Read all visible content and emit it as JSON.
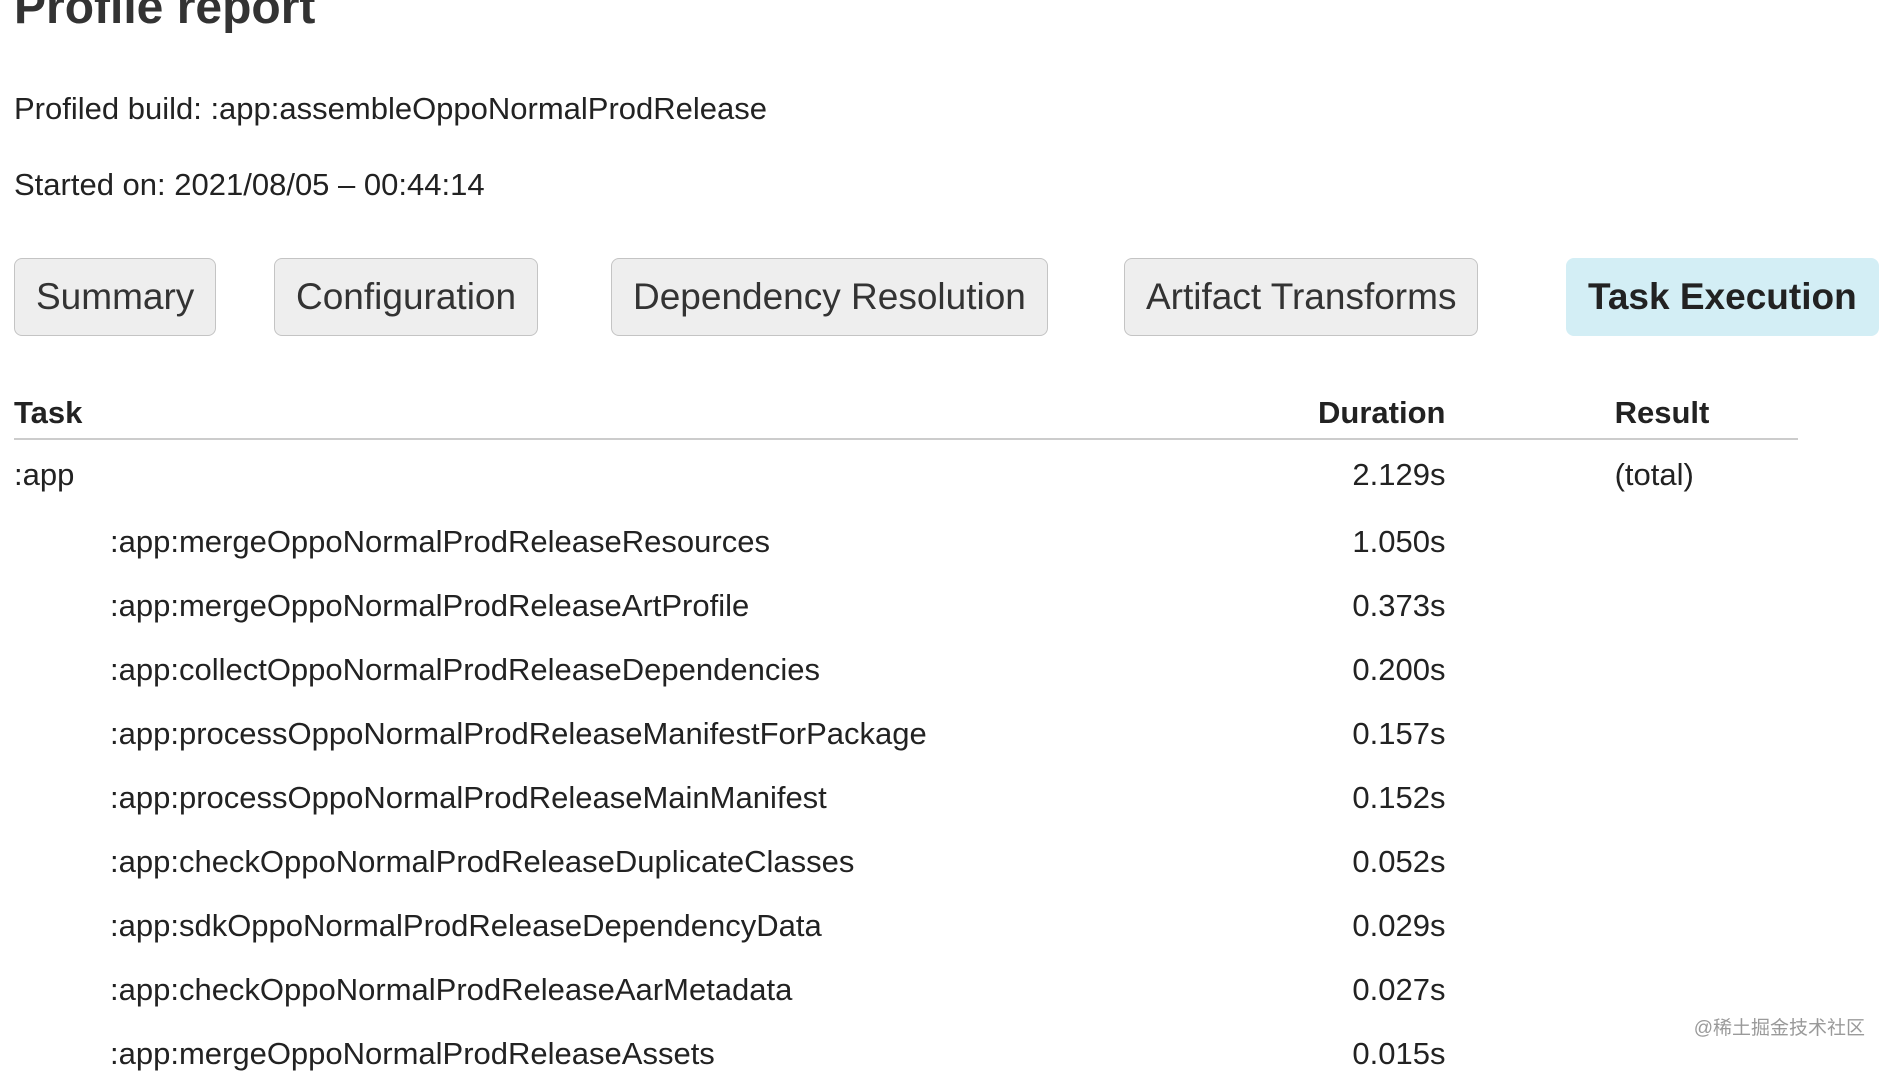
{
  "page": {
    "title": "Profile report",
    "profiled_build": "Profiled build: :app:assembleOppoNormalProdRelease",
    "started_on": "Started on: 2021/08/05 – 00:44:14"
  },
  "tabs": [
    {
      "label": "Summary",
      "active": false
    },
    {
      "label": "Configuration",
      "active": false
    },
    {
      "label": "Dependency Resolution",
      "active": false
    },
    {
      "label": "Artifact Transforms",
      "active": false
    },
    {
      "label": "Task Execution",
      "active": true
    }
  ],
  "table": {
    "headers": {
      "task": "Task",
      "duration": "Duration",
      "result": "Result"
    },
    "rows": [
      {
        "task": ":app",
        "duration": "2.129s",
        "result": "(total)"
      },
      {
        "task": ":app:mergeOppoNormalProdReleaseResources",
        "duration": "1.050s",
        "result": ""
      },
      {
        "task": ":app:mergeOppoNormalProdReleaseArtProfile",
        "duration": "0.373s",
        "result": ""
      },
      {
        "task": ":app:collectOppoNormalProdReleaseDependencies",
        "duration": "0.200s",
        "result": ""
      },
      {
        "task": ":app:processOppoNormalProdReleaseManifestForPackage",
        "duration": "0.157s",
        "result": ""
      },
      {
        "task": ":app:processOppoNormalProdReleaseMainManifest",
        "duration": "0.152s",
        "result": ""
      },
      {
        "task": ":app:checkOppoNormalProdReleaseDuplicateClasses",
        "duration": "0.052s",
        "result": ""
      },
      {
        "task": ":app:sdkOppoNormalProdReleaseDependencyData",
        "duration": "0.029s",
        "result": ""
      },
      {
        "task": ":app:checkOppoNormalProdReleaseAarMetadata",
        "duration": "0.027s",
        "result": ""
      },
      {
        "task": ":app:mergeOppoNormalProdReleaseAssets",
        "duration": "0.015s",
        "result": ""
      }
    ]
  },
  "watermark": "@稀土掘金技术社区",
  "colors": {
    "active_tab": "#d3eef5",
    "inactive_tab": "#eeeeee",
    "tab_border": "#c4c4c4",
    "header_rule": "#cccccc"
  }
}
